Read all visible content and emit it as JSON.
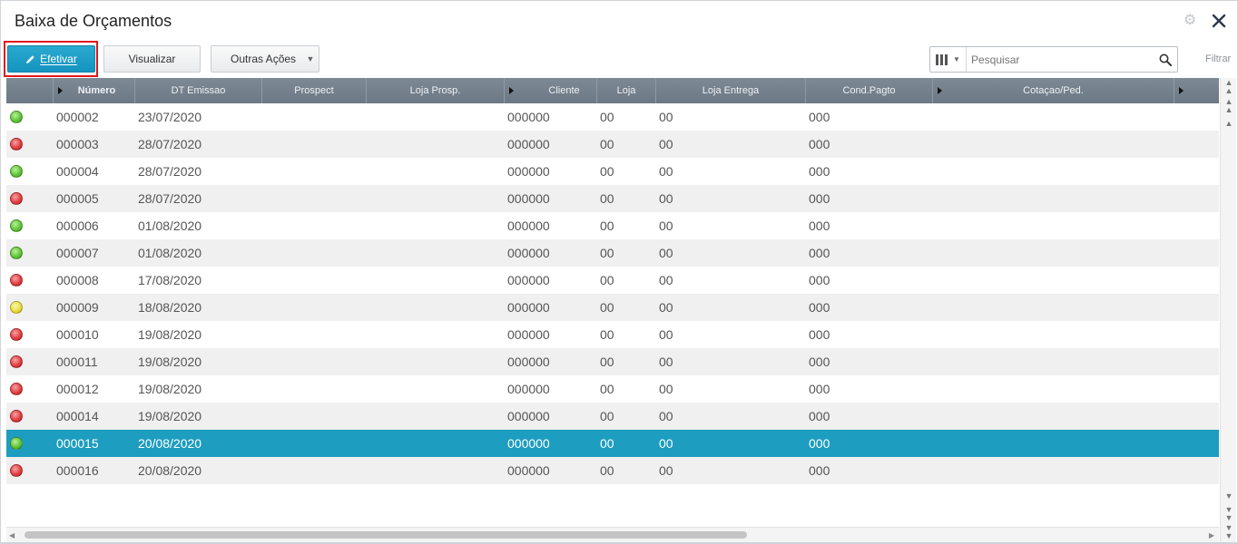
{
  "window": {
    "title": "Baixa de Orçamentos"
  },
  "toolbar": {
    "efetivar_label": "Efetivar",
    "visualizar_label": "Visualizar",
    "outras_label": "Outras Ações"
  },
  "search": {
    "placeholder": "Pesquisar",
    "filter_label": "Filtrar"
  },
  "colors": {
    "accent": "#1d9dc0",
    "status_green": "#5bc234",
    "status_red": "#e0393c",
    "status_yellow": "#e8dc3a"
  },
  "columns": [
    {
      "label": "Número"
    },
    {
      "label": "DT Emissao"
    },
    {
      "label": "Prospect"
    },
    {
      "label": "Loja Prosp."
    },
    {
      "label": "Cliente"
    },
    {
      "label": "Loja"
    },
    {
      "label": "Loja Entrega"
    },
    {
      "label": "Cond.Pagto"
    },
    {
      "label": "Cotaçao/Ped."
    }
  ],
  "rows": [
    {
      "status": "green",
      "numero": "000002",
      "dt": "23/07/2020",
      "cliente": "000000",
      "loja": "00",
      "entrega": "00",
      "cond": "000"
    },
    {
      "status": "red",
      "numero": "000003",
      "dt": "28/07/2020",
      "cliente": "000000",
      "loja": "00",
      "entrega": "00",
      "cond": "000"
    },
    {
      "status": "green",
      "numero": "000004",
      "dt": "28/07/2020",
      "cliente": "000000",
      "loja": "00",
      "entrega": "00",
      "cond": "000"
    },
    {
      "status": "red",
      "numero": "000005",
      "dt": "28/07/2020",
      "cliente": "000000",
      "loja": "00",
      "entrega": "00",
      "cond": "000"
    },
    {
      "status": "green",
      "numero": "000006",
      "dt": "01/08/2020",
      "cliente": "000000",
      "loja": "00",
      "entrega": "00",
      "cond": "000"
    },
    {
      "status": "green",
      "numero": "000007",
      "dt": "01/08/2020",
      "cliente": "000000",
      "loja": "00",
      "entrega": "00",
      "cond": "000"
    },
    {
      "status": "red",
      "numero": "000008",
      "dt": "17/08/2020",
      "cliente": "000000",
      "loja": "00",
      "entrega": "00",
      "cond": "000"
    },
    {
      "status": "yellow",
      "numero": "000009",
      "dt": "18/08/2020",
      "cliente": "000000",
      "loja": "00",
      "entrega": "00",
      "cond": "000"
    },
    {
      "status": "red",
      "numero": "000010",
      "dt": "19/08/2020",
      "cliente": "000000",
      "loja": "00",
      "entrega": "00",
      "cond": "000"
    },
    {
      "status": "red",
      "numero": "000011",
      "dt": "19/08/2020",
      "cliente": "000000",
      "loja": "00",
      "entrega": "00",
      "cond": "000"
    },
    {
      "status": "red",
      "numero": "000012",
      "dt": "19/08/2020",
      "cliente": "000000",
      "loja": "00",
      "entrega": "00",
      "cond": "000"
    },
    {
      "status": "red",
      "numero": "000014",
      "dt": "19/08/2020",
      "cliente": "000000",
      "loja": "00",
      "entrega": "00",
      "cond": "000"
    },
    {
      "status": "green",
      "numero": "000015",
      "dt": "20/08/2020",
      "cliente": "000000",
      "loja": "00",
      "entrega": "00",
      "cond": "000",
      "selected": true
    },
    {
      "status": "red",
      "numero": "000016",
      "dt": "20/08/2020",
      "cliente": "000000",
      "loja": "00",
      "entrega": "00",
      "cond": "000"
    }
  ],
  "icons": {
    "settings": "gear-icon",
    "close": "close-icon",
    "edit": "pencil-icon",
    "columns": "columns-icon",
    "search": "search-icon"
  }
}
